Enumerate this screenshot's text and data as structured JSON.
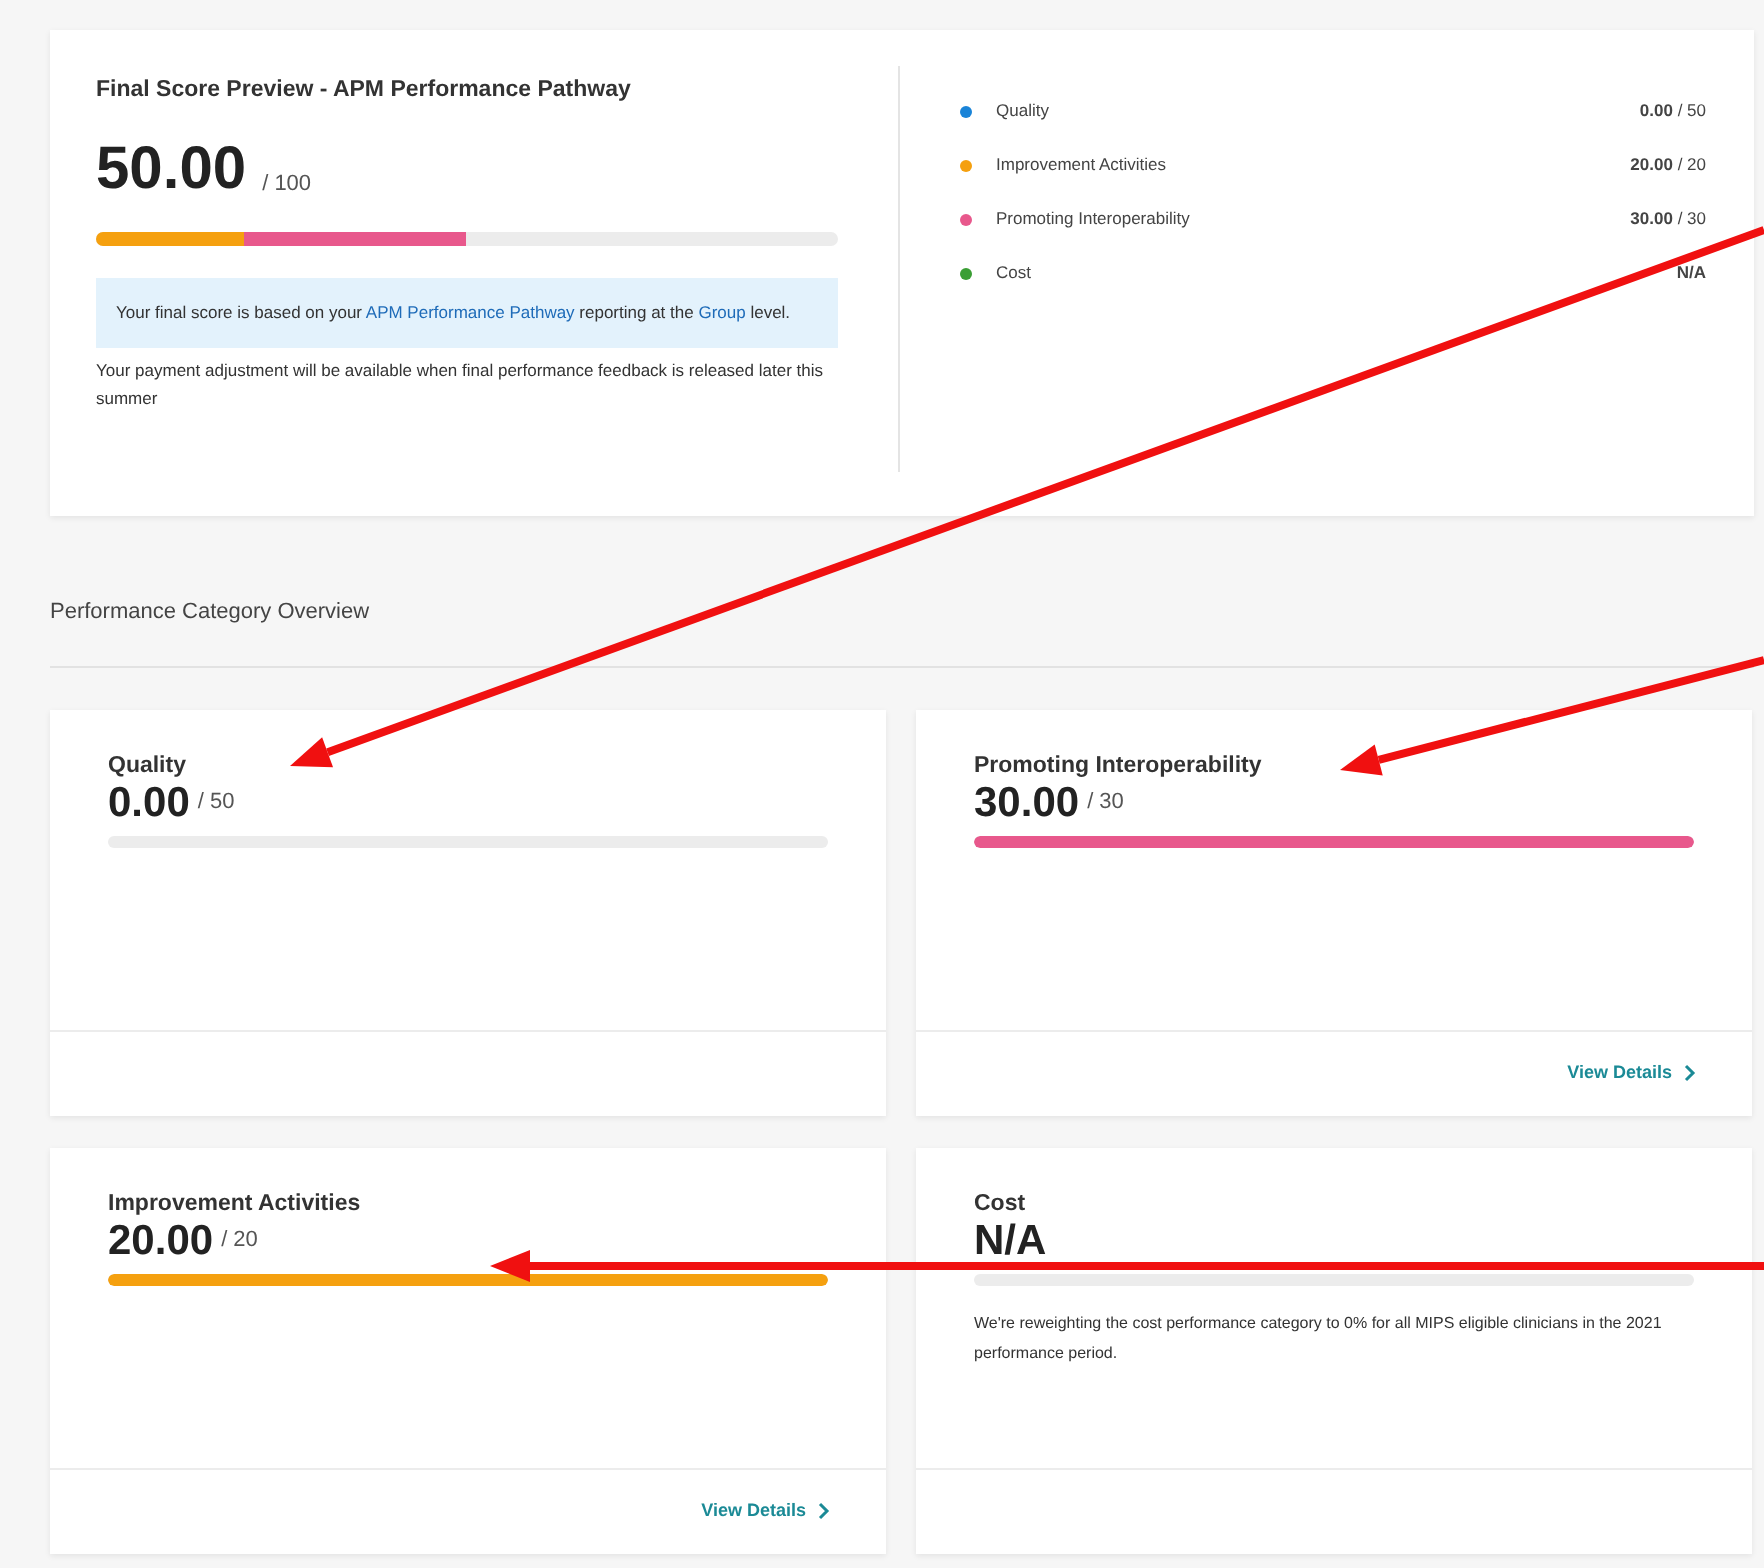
{
  "summary": {
    "title": "Final Score Preview - APM Performance Pathway",
    "score": "50.00",
    "max": "/ 100",
    "segments": [
      {
        "color": "#f5a00f",
        "level": 0.2
      },
      {
        "color": "#e8588c",
        "level": 0.3
      }
    ],
    "notice": [
      {
        "text": "Your final score is based on your ",
        "link": false
      },
      {
        "text": "APM Performance Pathway",
        "link": true
      },
      {
        "text": " reporting at the ",
        "link": false
      },
      {
        "text": "Group",
        "link": true
      },
      {
        "text": " level.",
        "link": false
      }
    ],
    "note": "Your payment adjustment will be available when final performance feedback is released later this summer"
  },
  "legend": [
    {
      "label": "Quality",
      "color": "#1a84d8",
      "value": "0.00",
      "max": "/ 50"
    },
    {
      "label": "Improvement Activities",
      "color": "#f5a00f",
      "value": "20.00",
      "max": "/ 20"
    },
    {
      "label": "Promoting Interoperability",
      "color": "#e8588c",
      "value": "30.00",
      "max": "/ 30"
    },
    {
      "label": "Cost",
      "color": "#3a9e34",
      "value": "N/A"
    }
  ],
  "section_title": "Performance Category Overview",
  "categories": [
    {
      "title": "Quality",
      "score": "0.00",
      "max": "/ 50",
      "level": 0
    },
    {
      "title": "Promoting Interoperability",
      "score": "30.00",
      "max": "/ 30",
      "level": 1,
      "color": "#e8588c",
      "link": "View Details"
    },
    {
      "title": "Improvement Activities",
      "score": "20.00",
      "max": "/ 20",
      "level": 1,
      "color": "#f5a00f",
      "link": "View Details"
    },
    {
      "title": "Cost",
      "score": "N/A",
      "level": 0,
      "description": "We're reweighting the cost performance category to 0% for all MIPS eligible clinicians in the 2021 performance period."
    }
  ]
}
